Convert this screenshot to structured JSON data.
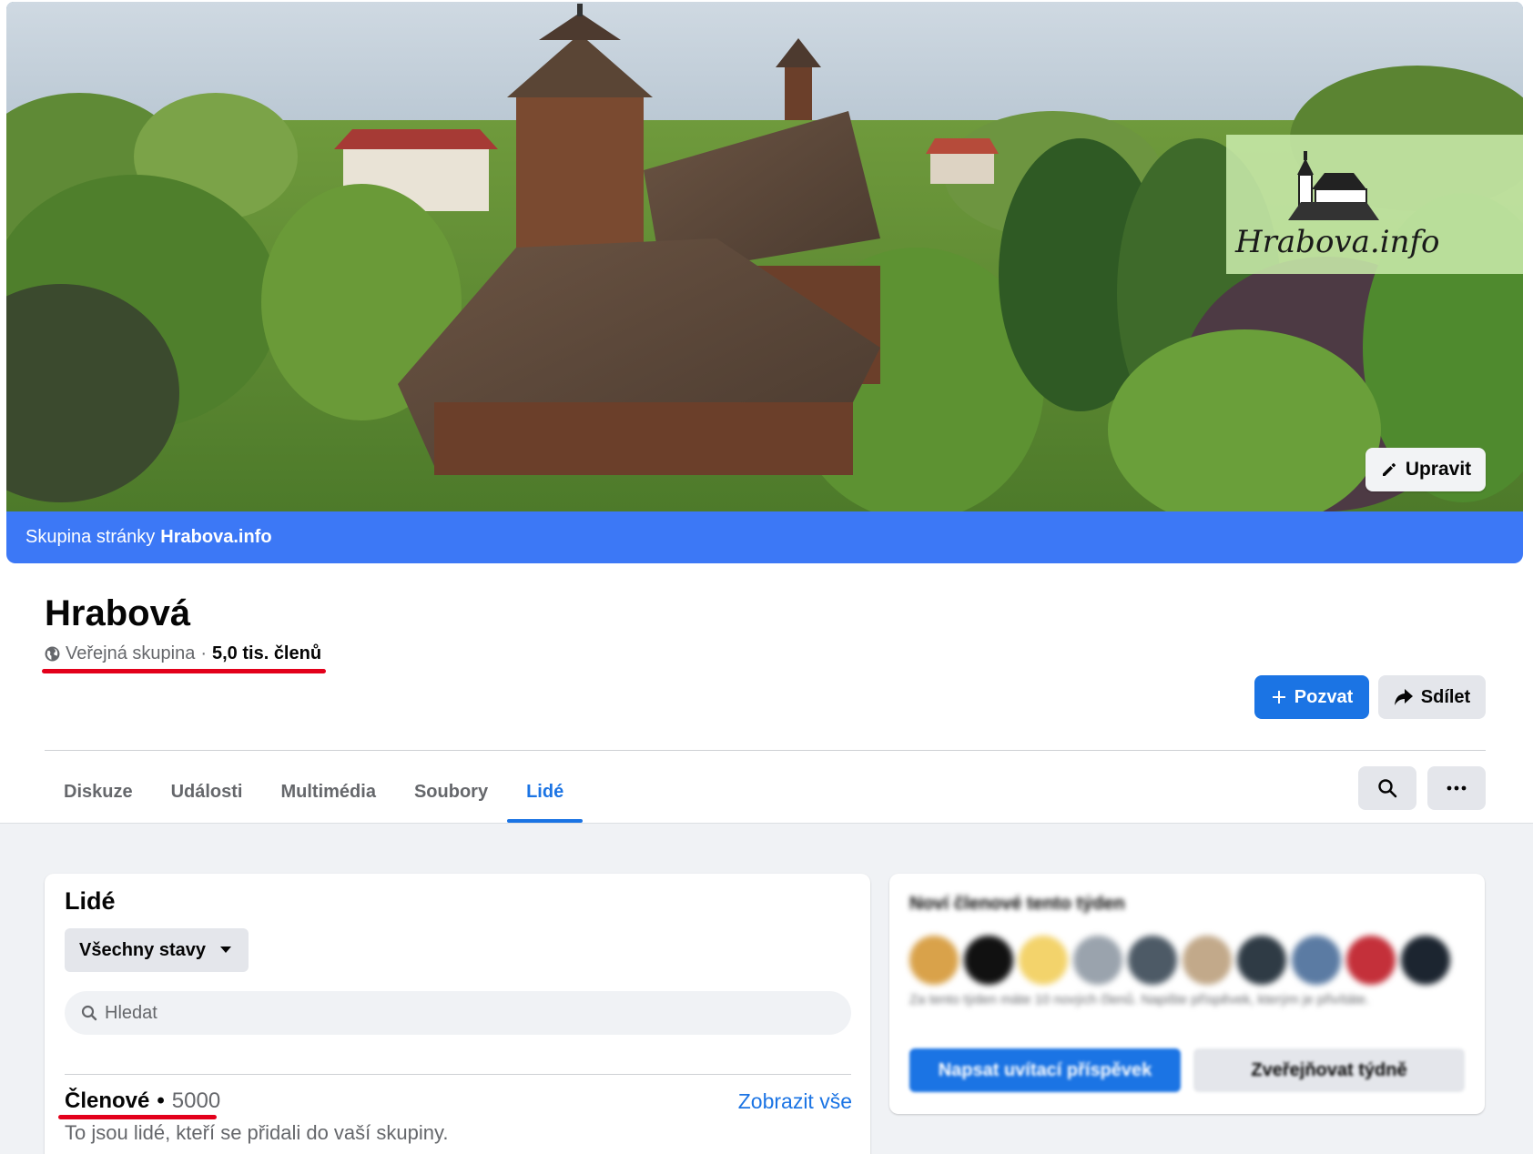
{
  "cover": {
    "edit_label": "Upravit",
    "logo_text": "Hrabova.info",
    "strip_prefix": "Skupina stránky",
    "strip_page": "Hrabova.info"
  },
  "group": {
    "name": "Hrabová",
    "privacy": "Veřejná skupina",
    "separator": "·",
    "members": "5,0 tis. členů",
    "invite_label": "Pozvat",
    "share_label": "Sdílet"
  },
  "tabs": [
    {
      "label": "Diskuze",
      "active": false
    },
    {
      "label": "Události",
      "active": false
    },
    {
      "label": "Multimédia",
      "active": false
    },
    {
      "label": "Soubory",
      "active": false
    },
    {
      "label": "Lidé",
      "active": true
    }
  ],
  "icons": {
    "search": "search-icon",
    "more": "more-icon",
    "globe": "globe-icon",
    "pencil": "pencil-icon",
    "plus": "plus-icon",
    "share": "share-icon",
    "dropdown": "caret-down-icon"
  },
  "people": {
    "title": "Lidé",
    "filter_value": "Všechny stavy",
    "search_placeholder": "Hledat",
    "members_label": "Členové",
    "members_separator": "•",
    "members_count": "5000",
    "show_all": "Zobrazit vše",
    "members_description": "To jsou lidé, kteří se přidali do vaší skupiny."
  },
  "new_members": {
    "title": "Noví členové tento týden",
    "description": "Za tento týden máte 10 nových členů. Napište příspěvek, kterým je přivítáte.",
    "welcome_button": "Napsat uvítací příspěvek",
    "weekly_button": "Zveřejňovat týdně",
    "avatar_colors": [
      "#d9a24a",
      "#111111",
      "#f3d36b",
      "#9aa3ad",
      "#4d5a66",
      "#c2a98a",
      "#2f3b45",
      "#5b7ba3",
      "#c4303a",
      "#1c2530"
    ]
  },
  "colors": {
    "accent": "#1b74e4",
    "strip": "#3c78f6",
    "highlight_underline": "#e3001b"
  }
}
